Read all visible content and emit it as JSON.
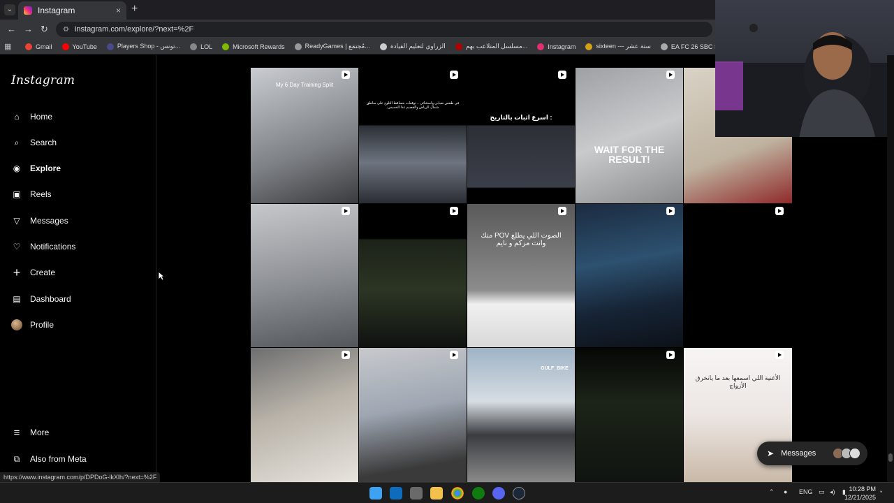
{
  "browser": {
    "tab_title": "Instagram",
    "tab_close": "×",
    "new_tab": "+",
    "url": "instagram.com/explore/?next=%2F",
    "back": "←",
    "forward": "→",
    "reload": "↻",
    "site_info": "⚙",
    "apps": "▦",
    "bookmarks": [
      {
        "label": "Gmail",
        "color": "#ea4335"
      },
      {
        "label": "YouTube",
        "color": "#ff0000"
      },
      {
        "label": "Players Shop - تونس...",
        "color": "#4a4a8a"
      },
      {
        "label": "LOL",
        "color": "#888888"
      },
      {
        "label": "Microsoft Rewards",
        "color": "#7fba00"
      },
      {
        "label": "ReadyGames | مُجتمَع...",
        "color": "#999999"
      },
      {
        "label": "الزراوي لتعليم القيادة",
        "color": "#cccccc"
      },
      {
        "label": "مسلسل المتلاعب بهم...",
        "color": "#b00000"
      },
      {
        "label": "Instagram",
        "color": "#e1306c"
      },
      {
        "label": "sixteen --- ستة عشر",
        "color": "#d4a017"
      },
      {
        "label": "EA FC 26 SBC Soluti...",
        "color": "#aaaaaa"
      }
    ]
  },
  "sidebar": {
    "logo": "Instagram",
    "items": [
      {
        "label": "Home",
        "icon": "home-icon",
        "glyph": "⌂"
      },
      {
        "label": "Search",
        "icon": "search-icon",
        "glyph": "⌕"
      },
      {
        "label": "Explore",
        "icon": "compass-icon",
        "glyph": "◉"
      },
      {
        "label": "Reels",
        "icon": "reels-icon",
        "glyph": "▣"
      },
      {
        "label": "Messages",
        "icon": "messenger-icon",
        "glyph": "▽"
      },
      {
        "label": "Notifications",
        "icon": "heart-icon",
        "glyph": "♡"
      },
      {
        "label": "Create",
        "icon": "plus-icon",
        "glyph": "+"
      },
      {
        "label": "Dashboard",
        "icon": "chart-icon",
        "glyph": "▤"
      },
      {
        "label": "Profile",
        "icon": "avatar",
        "glyph": ""
      }
    ],
    "more": {
      "label": "More",
      "glyph": "≡"
    },
    "meta": {
      "label": "Also from Meta",
      "glyph": "⧉"
    }
  },
  "grid": {
    "cells": [
      {
        "text": "My 6 Day Training Split",
        "bg": "linear-gradient(160deg,#c9ccd0,#7d8085 60%,#3a3b3e)"
      },
      {
        "text": "في طقس ضبابي واستثنائي .. توقعات بتساقط الثلوج على مناطق شمال الرياض والقصيم غدا الخميس.",
        "bg": "linear-gradient(180deg,#000 0%,#000 40%,#2c3036 41%,#6e7480 70%,#2a2d33)"
      },
      {
        "text": "اسرع اثبات بالتاريخ :",
        "bg": "linear-gradient(180deg,#000 0%,#000 42%,#1b1b1b 43%,#3b3f4a 80%,#000 86%)"
      },
      {
        "text": "WAIT FOR THE RESULT!",
        "bg": "linear-gradient(160deg,#9ea0a3,#c9cacc 50%,#8a8b8d)"
      },
      {
        "text": "",
        "bg": "linear-gradient(160deg,#d9d2c6,#bfb3a0 60%,#8f2a2a)"
      },
      {
        "text": "",
        "bg": "linear-gradient(170deg,#c6c8cb,#8b8e93 55%,#53565b)"
      },
      {
        "text": "",
        "bg": "linear-gradient(180deg,#000 0%,#000 24%,#1c2218 25%,#2c3524 60%,#0f1210)"
      },
      {
        "text": "الصوت اللي يطلع POV منك وانت مزكم و نايم",
        "bg": "linear-gradient(180deg,#5a5a5a,#8c8c8c 60%,#f0f0f0 70%,#d8d8d8)"
      },
      {
        "text": "",
        "bg": "linear-gradient(170deg,#1b2b40,#2d5170 40%,#162436 70%,#0d1118)"
      },
      {
        "text": "",
        "bg": "#000000"
      },
      {
        "text": "",
        "bg": "linear-gradient(160deg,#6d6e70,#b8b2a8 45%,#e8e4de)"
      },
      {
        "text": "",
        "bg": "linear-gradient(170deg,#c7c9cc,#9ea6b2 45%,#3a3a3a 85%)"
      },
      {
        "text": "GULF_BIKE",
        "bg": "linear-gradient(180deg,#9fb3c6,#d6dde3 40%,#3a3c40 65%,#8a8a8a)"
      },
      {
        "text": "",
        "bg": "linear-gradient(180deg,#050705,#1c2418 40%,#101410)"
      },
      {
        "text": "الأغنية اللي اسمعها بعد ما يانخرق الأزواج",
        "bg": "linear-gradient(180deg,#f7f5f4,#ece6e3 50%,#c9b9a8)"
      }
    ]
  },
  "messages_pill": {
    "label": "Messages"
  },
  "status_link": "https://www.instagram.com/p/DPDoG-lkXlh/?next=%2F",
  "taskbar": {
    "lang": "ENG",
    "time": "10:28 PM",
    "date": "12/21/2025"
  }
}
